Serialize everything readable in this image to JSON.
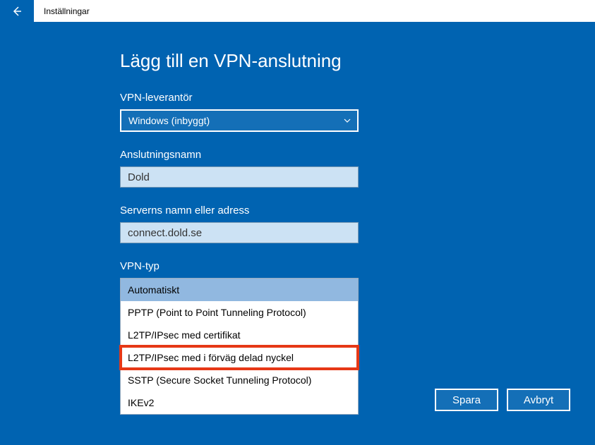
{
  "titlebar": {
    "label": "Inställningar"
  },
  "page": {
    "title": "Lägg till en VPN-anslutning"
  },
  "fields": {
    "provider": {
      "label": "VPN-leverantör",
      "value": "Windows (inbyggt)"
    },
    "connection_name": {
      "label": "Anslutningsnamn",
      "value": "Dold"
    },
    "server": {
      "label": "Serverns namn eller adress",
      "value": "connect.dold.se"
    },
    "vpn_type": {
      "label": "VPN-typ",
      "options": [
        "Automatiskt",
        "PPTP (Point to Point Tunneling Protocol)",
        "L2TP/IPsec med certifikat",
        "L2TP/IPsec med i förväg delad nyckel",
        "SSTP (Secure Socket Tunneling Protocol)",
        "IKEv2"
      ]
    }
  },
  "buttons": {
    "save": "Spara",
    "cancel": "Avbryt"
  }
}
